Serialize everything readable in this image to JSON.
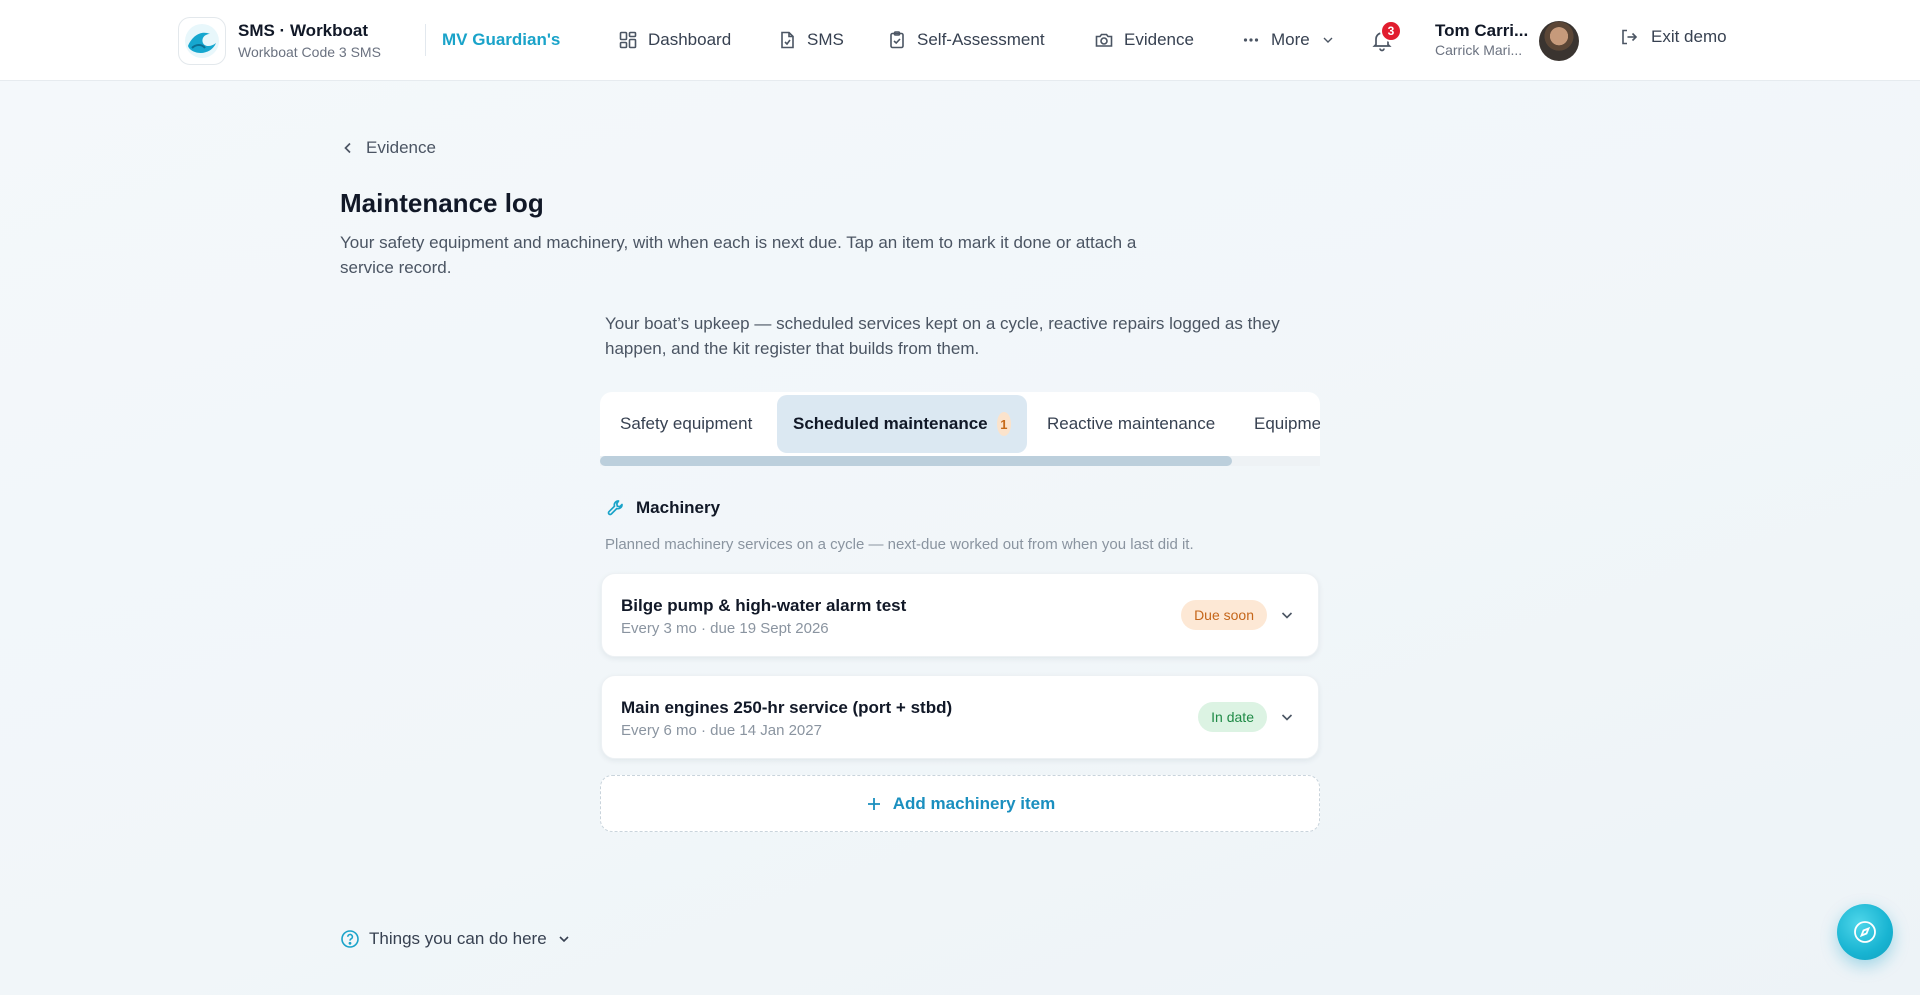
{
  "header": {
    "brand_title": "SMS · Workboat",
    "brand_subtitle": "Workboat Code 3 SMS",
    "vessel_name": "MV Guardian's",
    "nav": [
      {
        "label": "Dashboard",
        "icon": "dashboard-icon"
      },
      {
        "label": "SMS",
        "icon": "document-icon"
      },
      {
        "label": "Self-Assessment",
        "icon": "clipboard-check-icon"
      },
      {
        "label": "Evidence",
        "icon": "camera-icon"
      },
      {
        "label": "More",
        "icon": "more-dots-icon"
      }
    ],
    "notification_count": "3",
    "user_name": "Tom Carri...",
    "user_org": "Carrick Mari...",
    "exit_label": "Exit demo"
  },
  "page": {
    "back_label": "Evidence",
    "title": "Maintenance log",
    "description": "Your safety equipment and machinery, with when each is next due. Tap an item to mark it done or attach a service record.",
    "intro": "Your boat’s upkeep — scheduled services kept on a cycle, reactive repairs logged as they happen, and the kit register that builds from them."
  },
  "tabs": [
    {
      "label": "Safety equipment"
    },
    {
      "label": "Scheduled maintenance",
      "count": "1"
    },
    {
      "label": "Reactive maintenance"
    },
    {
      "label": "Equipme"
    }
  ],
  "section": {
    "title": "Machinery",
    "icon": "wrench-icon",
    "description": "Planned machinery services on a cycle — next-due worked out from when you last did it.",
    "items": [
      {
        "title": "Bilge pump & high-water alarm test",
        "subtitle": "Every 3 mo · due 19 Sept 2026",
        "status": "Due soon"
      },
      {
        "title": "Main engines 250-hr service (port + stbd)",
        "subtitle": "Every 6 mo · due 14 Jan 2027",
        "status": "In date"
      }
    ],
    "add_label": "Add machinery item"
  },
  "help_label": "Things you can do here",
  "colors": {
    "accent": "#1aa3c9",
    "due_soon": "#c5661a",
    "in_date": "#1f8a46",
    "badge": "#e11d2e"
  }
}
